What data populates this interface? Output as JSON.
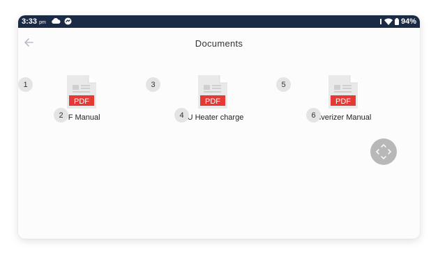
{
  "status_bar": {
    "time": "3:33",
    "ampm": "pm",
    "battery": "94%"
  },
  "header": {
    "title": "Documents"
  },
  "documents": [
    {
      "badge": "1",
      "name_badge": "2",
      "name": "PF Manual",
      "icon": "pdf-file-icon",
      "icon_label": "PDF"
    },
    {
      "badge": "3",
      "name_badge": "4",
      "name": "CU Heater charge",
      "icon": "pdf-file-icon",
      "icon_label": "PDF"
    },
    {
      "badge": "5",
      "name_badge": "6",
      "name": "ulverizer Manual",
      "icon": "pdf-file-icon",
      "icon_label": "PDF"
    }
  ],
  "icons": {
    "back": "arrow-left-icon",
    "navigator": "directional-pad-icon"
  },
  "colors": {
    "status_bar": "#1c2b45",
    "pdf_red": "#e53935",
    "page_gray": "#e9e9e9",
    "badge": "#e4e4e4",
    "fab": "#b8b8b8"
  }
}
